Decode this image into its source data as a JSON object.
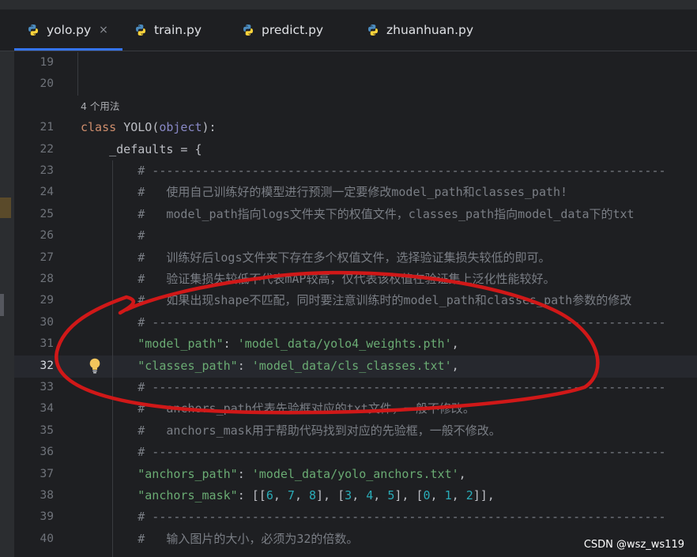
{
  "tabs": [
    {
      "label": "yolo.py",
      "active": true,
      "closable": true,
      "icon": "python-file-icon"
    },
    {
      "label": "train.py",
      "active": false,
      "icon": "python-file-icon"
    },
    {
      "label": "predict.py",
      "active": false,
      "icon": "python-file-icon"
    },
    {
      "label": "zhuanhuan.py",
      "active": false,
      "icon": "python-file-icon"
    }
  ],
  "close_glyph": "×",
  "usage_hint": "4 个用法",
  "current_line": 32,
  "lines": [
    {
      "num": "19",
      "tokens": []
    },
    {
      "num": "20",
      "tokens": []
    },
    {
      "num": "21",
      "tokens": [
        {
          "t": "class ",
          "c": "kw"
        },
        {
          "t": "YOLO",
          "c": "cls"
        },
        {
          "t": "(",
          "c": "plain"
        },
        {
          "t": "object",
          "c": "builtin"
        },
        {
          "t": "):",
          "c": "plain"
        }
      ]
    },
    {
      "num": "22",
      "tokens": [
        {
          "t": "    _defaults = {",
          "c": "plain"
        }
      ]
    },
    {
      "num": "23",
      "tokens": [
        {
          "t": "        # ------------------------------------------------------------------------",
          "c": "comment"
        }
      ]
    },
    {
      "num": "24",
      "tokens": [
        {
          "t": "        #   使用自己训练好的模型进行预测一定要修改model_path和classes_path!",
          "c": "comment"
        }
      ]
    },
    {
      "num": "25",
      "tokens": [
        {
          "t": "        #   model_path指向logs文件夹下的权值文件，classes_path指向model_data下的txt",
          "c": "comment"
        }
      ]
    },
    {
      "num": "26",
      "tokens": [
        {
          "t": "        #",
          "c": "comment"
        }
      ]
    },
    {
      "num": "27",
      "tokens": [
        {
          "t": "        #   训练好后logs文件夹下存在多个权值文件，选择验证集损失较低的即可。",
          "c": "comment"
        }
      ]
    },
    {
      "num": "28",
      "tokens": [
        {
          "t": "        #   验证集损失较低不代表mAP较高，仅代表该权值在验证集上泛化性能较好。",
          "c": "comment"
        }
      ]
    },
    {
      "num": "29",
      "tokens": [
        {
          "t": "        #   如果出现shape不匹配，同时要注意训练时的model_path和classes_path参数的修改",
          "c": "comment"
        }
      ]
    },
    {
      "num": "30",
      "tokens": [
        {
          "t": "        # ------------------------------------------------------------------------",
          "c": "comment"
        }
      ]
    },
    {
      "num": "31",
      "tokens": [
        {
          "t": "        ",
          "c": "plain"
        },
        {
          "t": "\"model_path\"",
          "c": "str"
        },
        {
          "t": ": ",
          "c": "plain"
        },
        {
          "t": "'model_data/yolo4_weights.pth'",
          "c": "str"
        },
        {
          "t": ",",
          "c": "plain"
        }
      ]
    },
    {
      "num": "32",
      "tokens": [
        {
          "t": "        ",
          "c": "plain"
        },
        {
          "t": "\"classes_path\"",
          "c": "str"
        },
        {
          "t": ": ",
          "c": "plain"
        },
        {
          "t": "'model_data/cls_classes.txt'",
          "c": "str"
        },
        {
          "t": ",",
          "c": "plain"
        }
      ]
    },
    {
      "num": "33",
      "tokens": [
        {
          "t": "        # ------------------------------------------------------------------------",
          "c": "comment"
        }
      ]
    },
    {
      "num": "34",
      "tokens": [
        {
          "t": "        #   anchors_path代表先验框对应的txt文件，一般不修改。",
          "c": "comment"
        }
      ]
    },
    {
      "num": "35",
      "tokens": [
        {
          "t": "        #   anchors_mask用于帮助代码找到对应的先验框，一般不修改。",
          "c": "comment"
        }
      ]
    },
    {
      "num": "36",
      "tokens": [
        {
          "t": "        # ------------------------------------------------------------------------",
          "c": "comment"
        }
      ]
    },
    {
      "num": "37",
      "tokens": [
        {
          "t": "        ",
          "c": "plain"
        },
        {
          "t": "\"anchors_path\"",
          "c": "str"
        },
        {
          "t": ": ",
          "c": "plain"
        },
        {
          "t": "'model_data/yolo_anchors.txt'",
          "c": "str"
        },
        {
          "t": ",",
          "c": "plain"
        }
      ]
    },
    {
      "num": "38",
      "tokens": [
        {
          "t": "        ",
          "c": "plain"
        },
        {
          "t": "\"anchors_mask\"",
          "c": "str"
        },
        {
          "t": ": [[",
          "c": "plain"
        },
        {
          "t": "6",
          "c": "num"
        },
        {
          "t": ", ",
          "c": "plain"
        },
        {
          "t": "7",
          "c": "num"
        },
        {
          "t": ", ",
          "c": "plain"
        },
        {
          "t": "8",
          "c": "num"
        },
        {
          "t": "], [",
          "c": "plain"
        },
        {
          "t": "3",
          "c": "num"
        },
        {
          "t": ", ",
          "c": "plain"
        },
        {
          "t": "4",
          "c": "num"
        },
        {
          "t": ", ",
          "c": "plain"
        },
        {
          "t": "5",
          "c": "num"
        },
        {
          "t": "], [",
          "c": "plain"
        },
        {
          "t": "0",
          "c": "num"
        },
        {
          "t": ", ",
          "c": "plain"
        },
        {
          "t": "1",
          "c": "num"
        },
        {
          "t": ", ",
          "c": "plain"
        },
        {
          "t": "2",
          "c": "num"
        },
        {
          "t": "]],",
          "c": "plain"
        }
      ]
    },
    {
      "num": "39",
      "tokens": [
        {
          "t": "        # ------------------------------------------------------------------------",
          "c": "comment"
        }
      ]
    },
    {
      "num": "40",
      "tokens": [
        {
          "t": "        #   输入图片的大小，必须为32的倍数。",
          "c": "comment"
        }
      ]
    }
  ],
  "watermark": "CSDN @wsz_ws119",
  "colors": {
    "background": "#1e1f22",
    "keyword": "#cf8e6d",
    "string": "#6aab73",
    "number": "#2aacb8",
    "comment": "#7a7e85",
    "builtin": "#8888c6",
    "active_tab_underline": "#3574f0",
    "annotation_red": "#d01818"
  }
}
